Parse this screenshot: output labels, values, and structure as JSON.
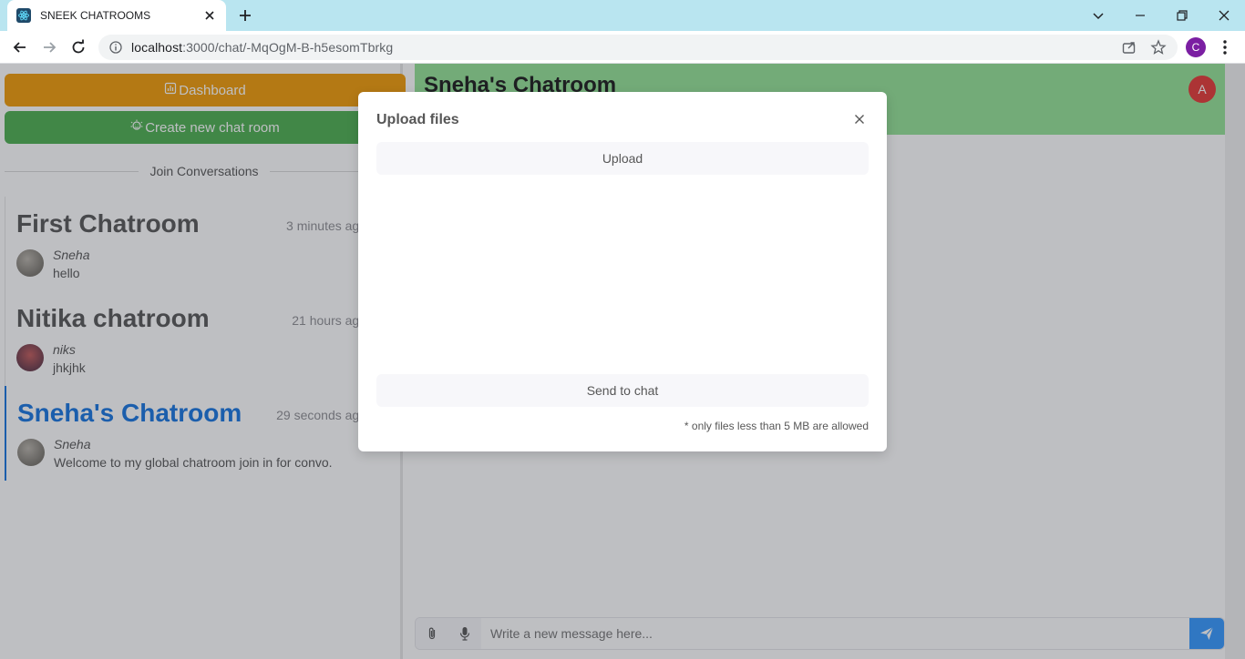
{
  "browser": {
    "tab_title": "SNEEK CHATROOMS",
    "url_host": "localhost",
    "url_path": ":3000/chat/-MqOgM-B-h5esomTbrkg",
    "profile_initial": "C"
  },
  "sidebar": {
    "dashboard_label": "Dashboard",
    "create_room_label": "Create new chat room",
    "divider_label": "Join Conversations",
    "rooms": [
      {
        "name": "First Chatroom",
        "time": "3 minutes ago",
        "author": "Sneha",
        "message": "hello",
        "active": false
      },
      {
        "name": "Nitika chatroom",
        "time": "21 hours ago",
        "author": "niks",
        "message": "jhkjhk",
        "active": false
      },
      {
        "name": "Sneha's Chatroom",
        "time": "29 seconds ago",
        "author": "Sneha",
        "message": "Welcome to my global chatroom join in for convo.",
        "active": true
      }
    ]
  },
  "chat": {
    "title": "Sneha's Chatroom",
    "avatar_initial": "A",
    "input_placeholder": "Write a new message here..."
  },
  "modal": {
    "title": "Upload files",
    "upload_label": "Upload",
    "send_label": "Send to chat",
    "note": "* only files less than 5 MB are allowed"
  },
  "colors": {
    "dashboard_btn": "#f19b06",
    "create_btn": "#4caf50",
    "chat_header": "#94e396",
    "active_room": "#1675e0",
    "avatar_red": "#e53935",
    "send_btn": "#3498ff"
  },
  "icons": {
    "tab_favicon": "react-icon",
    "dashboard": "dashboard-icon",
    "create_room": "creative-icon",
    "attach": "paperclip-icon",
    "mic": "microphone-icon",
    "send": "send-icon",
    "close": "close-icon"
  }
}
